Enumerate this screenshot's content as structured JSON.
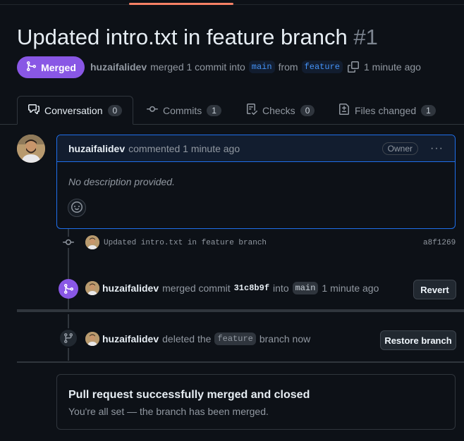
{
  "pr": {
    "title": "Updated intro.txt in feature branch",
    "number": "#1",
    "status": "Merged",
    "author": "huzaifalidev",
    "merged_text": "merged 1 commit into",
    "base_branch": "main",
    "from_text": "from",
    "head_branch": "feature",
    "time": "1 minute ago"
  },
  "tabs": [
    {
      "label": "Conversation",
      "count": "0"
    },
    {
      "label": "Commits",
      "count": "1"
    },
    {
      "label": "Checks",
      "count": "0"
    },
    {
      "label": "Files changed",
      "count": "1"
    }
  ],
  "comment": {
    "author": "huzaifalidev",
    "action": "commented 1 minute ago",
    "role": "Owner",
    "more": "···",
    "body": "No description provided."
  },
  "commit": {
    "message": "Updated intro.txt in feature branch",
    "sha": "a8f1269"
  },
  "merge_event": {
    "author": "huzaifalidev",
    "text1": "merged commit",
    "sha": "31c8b9f",
    "text2": "into",
    "branch": "main",
    "time": "1 minute ago",
    "button": "Revert"
  },
  "delete_event": {
    "author": "huzaifalidev",
    "text1": "deleted the",
    "branch": "feature",
    "text2": "branch now",
    "button": "Restore branch"
  },
  "merged_box": {
    "heading": "Pull request successfully merged and closed",
    "subtext": "You're all set — the branch has been merged."
  },
  "colors": {
    "merged": "#8957e5",
    "accent_blue": "#1f6feb",
    "background": "#0d1117"
  }
}
